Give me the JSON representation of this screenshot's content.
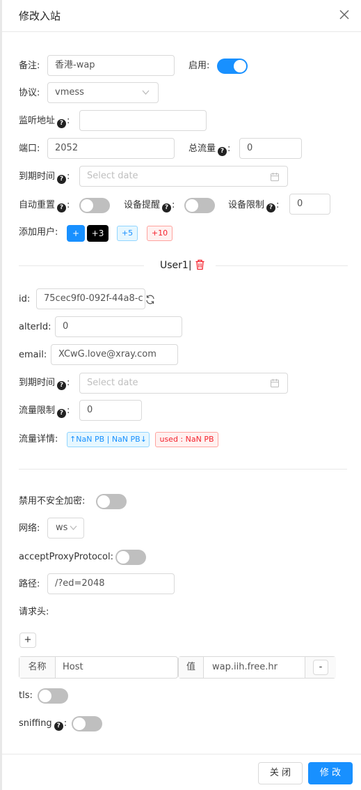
{
  "modal": {
    "title": "修改入站",
    "close_icon": "close-icon"
  },
  "form": {
    "remark": {
      "label": "备注:",
      "value": "香港-wap"
    },
    "enable": {
      "label": "启用:",
      "on": true
    },
    "protocol": {
      "label": "协议:",
      "value": "vmess"
    },
    "listen": {
      "label": "监听地址",
      "value": ""
    },
    "port": {
      "label": "端口:",
      "value": "2052"
    },
    "total_traffic": {
      "label": "总流量",
      "value": "0"
    },
    "expiry": {
      "label": "到期时间",
      "placeholder": "Select date"
    },
    "auto_reset": {
      "label": "自动重置",
      "on": false
    },
    "device_alert": {
      "label": "设备提醒",
      "on": false
    },
    "device_limit": {
      "label": "设备限制",
      "value": "0"
    },
    "add_user": {
      "label": "添加用户:",
      "buttons": [
        "+",
        "+3",
        "+5",
        "+10"
      ]
    }
  },
  "user": {
    "header": "User1|",
    "id": {
      "label": "id:",
      "value": "75cec9f0-092f-44a8-c"
    },
    "alter_id": {
      "label": "alterId:",
      "value": "0"
    },
    "email": {
      "label": "email:",
      "value": "XCwG.love@xray.com"
    },
    "expiry": {
      "label": "到期时间",
      "placeholder": "Select date"
    },
    "traffic_limit": {
      "label": "流量限制",
      "value": "0"
    },
    "traffic_detail": {
      "label": "流量详情:",
      "updown": "↑NaN PB | NaN PB↓",
      "used": "used : NaN PB"
    }
  },
  "stream": {
    "disable_insecure": {
      "label": "禁用不安全加密:",
      "on": false
    },
    "network": {
      "label": "网络:",
      "value": "ws"
    },
    "accept_proxy": {
      "label": "acceptProxyProtocol:",
      "on": false
    },
    "path": {
      "label": "路径:",
      "value": "/?ed=2048"
    },
    "headers": {
      "label": "请求头:",
      "add": "+",
      "name_label": "名称",
      "name_value": "Host",
      "value_label": "值",
      "value_value": "wap.iih.free.hr",
      "remove": "-"
    },
    "tls": {
      "label": "tls:",
      "on": false
    },
    "sniffing": {
      "label": "sniffing",
      "on": false
    }
  },
  "footer": {
    "close_label": "关 闭",
    "submit_label": "修 改"
  },
  "colors": {
    "primary": "#1890ff",
    "danger": "#f5222d",
    "toggle_off": "#bfbfbf"
  }
}
